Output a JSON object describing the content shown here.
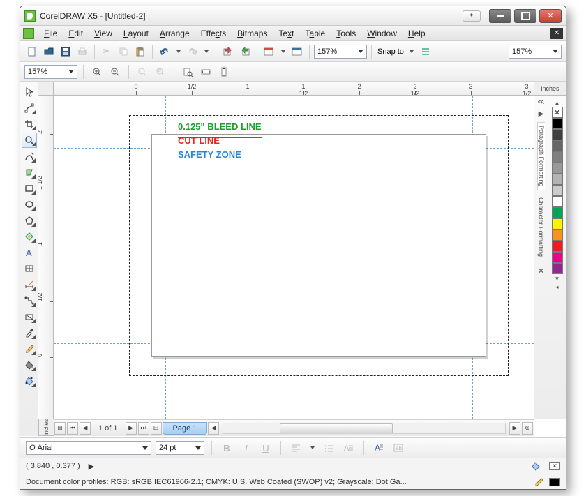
{
  "title": "CorelDRAW X5 - [Untitled-2]",
  "menu": {
    "file": "File",
    "edit": "Edit",
    "view": "View",
    "layout": "Layout",
    "arrange": "Arrange",
    "effects": "Effects",
    "bitmaps": "Bitmaps",
    "text": "Text",
    "table": "Table",
    "tools": "Tools",
    "window": "Window",
    "help": "Help"
  },
  "toolbar": {
    "zoom1": "157%",
    "snap_label": "Snap to",
    "zoom2": "157%"
  },
  "toolbar2": {
    "zoom": "157%"
  },
  "ruler": {
    "units": "inches",
    "h": [
      "0",
      "1/2",
      "1",
      "1 1/2",
      "2",
      "2 1/2",
      "3",
      "3 1/2"
    ],
    "v": [
      "2",
      "1 1/2",
      "1",
      "1/2",
      "0"
    ]
  },
  "canvas": {
    "bleed_label": "0.125\" BLEED LINE",
    "cut_label": "CUT LINE",
    "safety_label": "SAFETY ZONE"
  },
  "pagebar": {
    "counter": "1 of 1",
    "tab": "Page 1"
  },
  "propbar": {
    "font": "Arial",
    "size": "24 pt"
  },
  "status": {
    "coords": "( 3.840 , 0.377 )",
    "profiles": "Document color profiles: RGB: sRGB IEC61966-2.1; CMYK: U.S. Web Coated (SWOP) v2; Grayscale: Dot Ga..."
  },
  "dockers": {
    "p": "Paragraph Formatting",
    "c": "Character Formatting"
  },
  "palette": [
    "#000000",
    "#404040",
    "#666666",
    "#808080",
    "#999999",
    "#b3b3b3",
    "#cccccc",
    "#ffffff",
    "#00a651",
    "#fff200",
    "#f7941d",
    "#ed1c24",
    "#ec008c",
    "#92278f"
  ]
}
